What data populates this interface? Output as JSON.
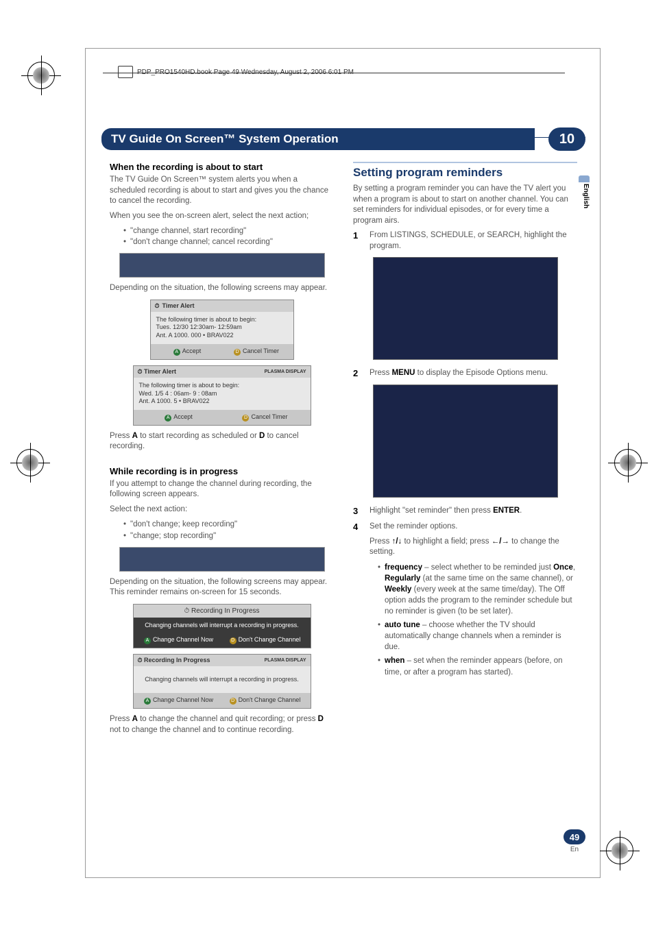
{
  "page_meta": {
    "filename": "PDP_PRO1540HD.book  Page 49  Wednesday, August 2, 2006  6:01 PM"
  },
  "header": {
    "title": "TV Guide On Screen™ System Operation",
    "chapter": "10"
  },
  "side_tab": "English",
  "footer": {
    "page_num": "49",
    "lang": "En"
  },
  "left": {
    "s1_head": "When the recording is about to start",
    "s1_p1": "The TV Guide On Screen™ system alerts you when a scheduled recording is about to start and gives you the chance to cancel the recording.",
    "s1_p2": "When you see the on-screen alert, select the next action;",
    "s1_b1": "\"change channel, start recording\"",
    "s1_b2": "\"don't change channel; cancel recording\"",
    "s1_p3": "Depending on the situation, the following screens may appear.",
    "dlg1": {
      "title": "Timer  Alert",
      "line1": "The following timer is about to begin:",
      "line2": "Tues. 12/30 12:30am- 12:59am",
      "line3": "Ant. A 1000. 000 • BRAV022",
      "btn_a": "Accept",
      "btn_d": "Cancel Timer"
    },
    "dlg2": {
      "title": "Timer  Alert",
      "badge": "PLASMA DISPLAY",
      "line1": "The following timer is about to begin:",
      "line2": "Wed.    1/5       4 : 06am-   9 : 08am",
      "line3": "Ant.   A     1000.  5     • BRAV022",
      "btn_a": "Accept",
      "btn_d": "Cancel Timer"
    },
    "s1_p4_a": "Press ",
    "s1_p4_b": " to start recording as scheduled or ",
    "s1_p4_c": " to cancel recording.",
    "s2_head": "While recording is in progress",
    "s2_p1": "If you attempt to change the channel during recording, the following screen appears.",
    "s2_p2": "Select the next action:",
    "s2_b1": "\"don't change; keep recording\"",
    "s2_b2": "\"change; stop recording\"",
    "s2_p3": "Depending on the situation, the following screens may appear. This reminder remains on-screen for 15 seconds.",
    "dlg3": {
      "head": "Recording In Progress",
      "msg": "Changing channels will interrupt a recording in progress.",
      "btn_a": "Change Channel Now",
      "btn_d": "Don't Change Channel"
    },
    "dlg4": {
      "title": "Recording In Progress",
      "badge": "PLASMA DISPLAY",
      "msg": "Changing channels will interrupt a recording in progress.",
      "btn_a": "Change Channel Now",
      "btn_d": "Don't Change Channel"
    },
    "s2_p4_a": "Press ",
    "s2_p4_b": " to change the channel and quit recording; or press ",
    "s2_p4_c": " not to change the channel and to continue recording."
  },
  "right": {
    "h2": "Setting program reminders",
    "p1": "By setting a program reminder you can have the TV alert you when a program is about to start on another channel. You can set reminders for individual episodes, or for every time a program airs.",
    "step1": "From LISTINGS, SCHEDULE, or SEARCH, highlight the program.",
    "step2_a": "Press ",
    "step2_menu": "MENU",
    "step2_b": " to display the Episode Options menu.",
    "step3_a": "Highlight \"set reminder\" then press ",
    "step3_enter": "ENTER",
    "step3_b": ".",
    "step4": "Set the reminder options.",
    "step4_p_a": "Press ",
    "step4_p_b": " to highlight a field; press ",
    "step4_p_c": " to change the setting.",
    "opt1_a": "frequency",
    "opt1_b": " – select whether to be reminded just ",
    "opt1_once": "Once",
    "opt1_c": ", ",
    "opt1_reg": "Regularly",
    "opt1_d": " (at the same time on the same channel), or ",
    "opt1_weekly": "Weekly",
    "opt1_e": " (every week at the same time/day). The Off option adds the program to the reminder schedule but no reminder is given (to be set later).",
    "opt2_a": "auto tune",
    "opt2_b": " – choose whether the TV should automatically change channels when a reminder is due.",
    "opt3_a": "when",
    "opt3_b": " – set when the reminder appears (before, on time, or after a program has started)."
  },
  "keys": {
    "A": "A",
    "D": "D"
  },
  "arrows": {
    "updown": "↑/↓",
    "leftright": "←/→"
  }
}
